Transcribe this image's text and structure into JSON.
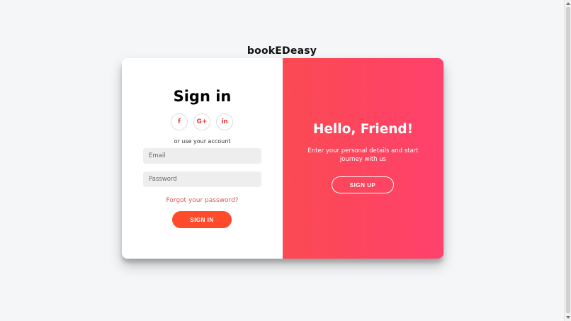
{
  "app": {
    "brand": "bookEDeasy"
  },
  "signin": {
    "title": "Sign in",
    "social": {
      "facebook_label": "f",
      "google_label": "G+",
      "linkedin_label": "in"
    },
    "or_text": "or use your account",
    "email_placeholder": "Email",
    "password_placeholder": "Password",
    "forgot_text": "Forgot your password?",
    "signin_button": "Sign In"
  },
  "overlay": {
    "title": "Hello, Friend!",
    "text": "Enter your personal details and start journey with us",
    "signup_button": "Sign Up"
  },
  "colors": {
    "primary": "#ff4b2b",
    "gradient_start": "#fb4a52",
    "gradient_end": "#ff416c",
    "link": "#d55b4e"
  },
  "icons": {
    "facebook": "facebook-icon",
    "google": "google-plus-icon",
    "linkedin": "linkedin-icon"
  }
}
